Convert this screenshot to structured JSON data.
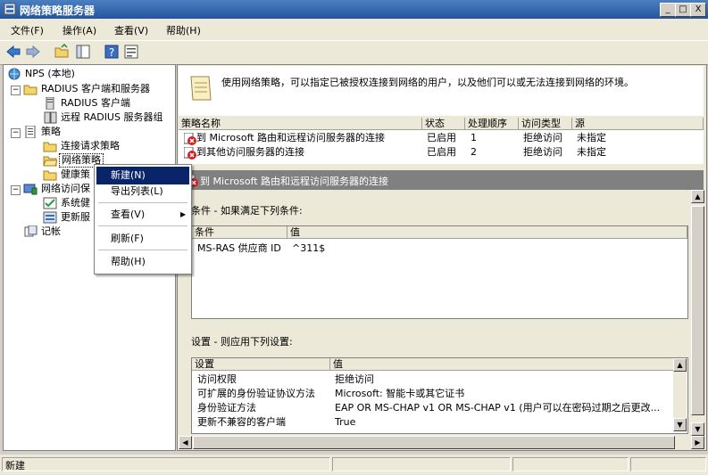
{
  "window": {
    "title": "网络策略服务器"
  },
  "titlebar_buttons": [
    "_",
    "□",
    "X"
  ],
  "menu": [
    "文件(F)",
    "操作(A)",
    "查看(V)",
    "帮助(H)"
  ],
  "tree": {
    "root": "NPS (本地)",
    "radius": "RADIUS 客户端和服务器",
    "radius_clients": "RADIUS 客户端",
    "remote_groups": "远程 RADIUS 服务器组",
    "policies": "策略",
    "conn_req": "连接请求策略",
    "net_policy": "网络策略",
    "health": "健康策",
    "nap": "网络访问保",
    "system_health": "系统健",
    "update_server": "更新服",
    "accounting": "记帐"
  },
  "info": {
    "text": "使用网络策略，可以指定已被授权连接到网络的用户，以及他们可以或无法连接到网络的环境。"
  },
  "policy_list": {
    "columns": [
      "策略名称",
      "状态",
      "处理顺序",
      "访问类型",
      "源"
    ],
    "rows": [
      {
        "name": "到 Microsoft 路由和远程访问服务器的连接",
        "status": "已启用",
        "order": "1",
        "access": "拒绝访问",
        "source": "未指定"
      },
      {
        "name": "到其他访问服务器的连接",
        "status": "已启用",
        "order": "2",
        "access": "拒绝访问",
        "source": "未指定"
      }
    ]
  },
  "detail": {
    "header": "到 Microsoft 路由和远程访问服务器的连接",
    "conditions_title": "条件 - 如果满足下列条件:",
    "cond_columns": [
      "条件",
      "值"
    ],
    "cond_rows": [
      {
        "k": "MS-RAS 供应商 ID",
        "v": "^311$"
      }
    ],
    "settings_title": "设置 - 则应用下列设置:",
    "set_columns": [
      "设置",
      "值"
    ],
    "set_rows": [
      {
        "k": "访问权限",
        "v": "拒绝访问"
      },
      {
        "k": "可扩展的身份验证协议方法",
        "v": "Microsoft: 智能卡或其它证书"
      },
      {
        "k": "身份验证方法",
        "v": "EAP OR MS-CHAP v1 OR MS-CHAP v1 (用户可以在密码过期之后更改..."
      },
      {
        "k": "更新不兼容的客户端",
        "v": "True"
      }
    ]
  },
  "context_menu": {
    "new": "新建(N)",
    "export": "导出列表(L)",
    "view": "查看(V)",
    "refresh": "刷新(F)",
    "help": "帮助(H)"
  },
  "status": {
    "text": "新建"
  },
  "colors": {
    "title_start": "#4a7fc0",
    "title_end": "#23549e",
    "selection": "#0a246a",
    "deny_icon": "#d02020"
  }
}
